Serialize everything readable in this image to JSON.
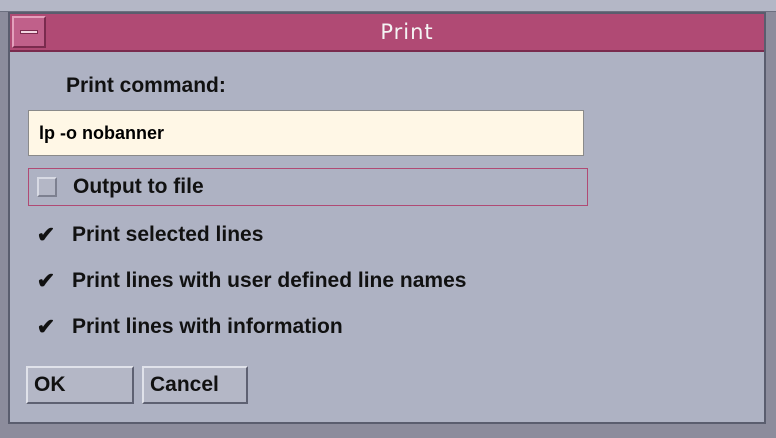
{
  "window": {
    "title": "Print"
  },
  "form": {
    "command_label": "Print command:",
    "command_value": "lp -o nobanner"
  },
  "options": [
    {
      "label": "Output to file",
      "checked": false
    },
    {
      "label": "Print selected lines",
      "checked": true
    },
    {
      "label": "Print lines with user defined line names",
      "checked": true
    },
    {
      "label": "Print lines with information",
      "checked": true
    }
  ],
  "buttons": {
    "ok": "OK",
    "cancel": "Cancel"
  },
  "icons": {
    "check": "✔"
  }
}
